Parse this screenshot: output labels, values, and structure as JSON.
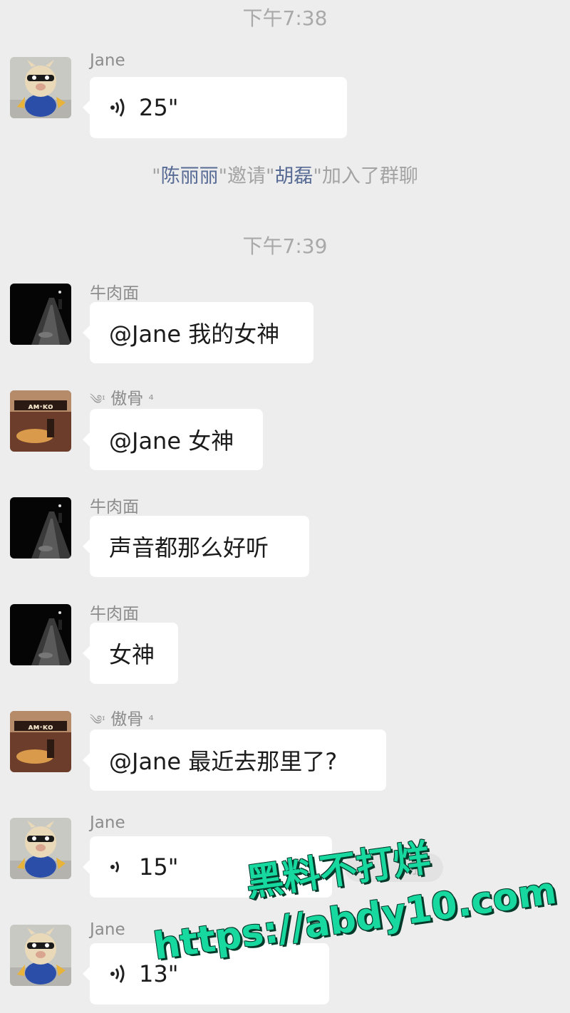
{
  "chat": {
    "times": [
      "下午7:38",
      "下午7:39"
    ],
    "system_notice": {
      "q1": "\"",
      "inviter": "陈丽丽",
      "middle": "\"邀请\"",
      "invitee": "胡磊",
      "end": "\"加入了群聊"
    },
    "messages": [
      {
        "sender": "Jane",
        "avatar": "cartoon-pig-avatar",
        "type": "voice",
        "text": "25\""
      },
      {
        "sender": "牛肉面",
        "avatar": "night-street-avatar",
        "type": "text",
        "text": "@Jane 我的女神"
      },
      {
        "sender": "傲骨",
        "sender_prefix": "༄ᶦ",
        "sender_suffix": "⁴",
        "avatar": "poster-avatar",
        "type": "text",
        "text": "@Jane 女神"
      },
      {
        "sender": "牛肉面",
        "avatar": "night-street-avatar",
        "type": "text",
        "text": "声音都那么好听"
      },
      {
        "sender": "牛肉面",
        "avatar": "night-street-avatar",
        "type": "text",
        "text": "女神"
      },
      {
        "sender": "傲骨",
        "sender_prefix": "༄ᶦ",
        "sender_suffix": "⁴",
        "avatar": "poster-avatar",
        "type": "text",
        "text": "@Jane 最近去那里了?"
      },
      {
        "sender": "Jane",
        "avatar": "cartoon-pig-avatar",
        "type": "voice",
        "text": "15\""
      },
      {
        "sender": "Jane",
        "avatar": "cartoon-pig-avatar",
        "type": "voice",
        "text": "13\""
      }
    ],
    "play_hint": "放"
  },
  "watermark": {
    "line1": "黑料不打烊",
    "line2": "https://abdy10.com"
  },
  "colors": {
    "background": "#ededed",
    "bubble": "#ffffff",
    "name_link": "#576b95",
    "watermark": "#17d9a0"
  }
}
